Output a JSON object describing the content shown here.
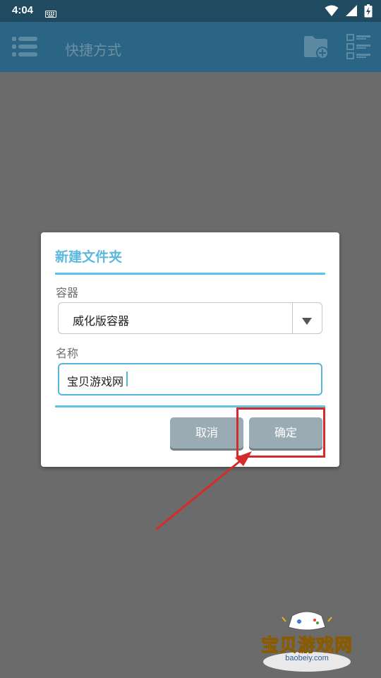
{
  "status_bar": {
    "time": "4:04",
    "icons": [
      "keyboard-icon",
      "wifi-icon",
      "signal-icon",
      "battery-charging-icon"
    ]
  },
  "app_bar": {
    "title": "快捷方式",
    "icons": [
      "menu-icon",
      "add-folder-icon",
      "list-view-icon"
    ]
  },
  "dialog": {
    "title": "新建文件夹",
    "container": {
      "label": "容器",
      "selected": "威化版容器"
    },
    "name": {
      "label": "名称",
      "value": "宝贝游戏网"
    },
    "buttons": {
      "cancel": "取消",
      "ok": "确定"
    }
  },
  "watermark": {
    "text": "宝贝游戏网",
    "url": "baobeiy.com"
  },
  "colors": {
    "app_bar": "#2b6585",
    "status_bar": "#1f4a60",
    "accent": "#5bb8de",
    "button": "#9aabb3",
    "annotation": "#d52b2b",
    "overlay": "#6b6b6b"
  }
}
